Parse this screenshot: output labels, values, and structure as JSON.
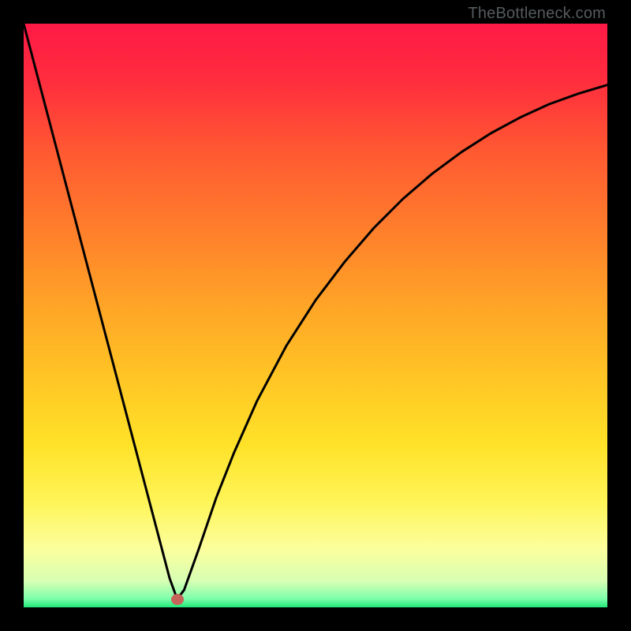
{
  "watermark": "TheBottleneck.com",
  "gradient_stops": [
    {
      "offset": 0.0,
      "color": "#ff1a46"
    },
    {
      "offset": 0.1,
      "color": "#ff2e3e"
    },
    {
      "offset": 0.22,
      "color": "#ff5a32"
    },
    {
      "offset": 0.35,
      "color": "#ff7e2c"
    },
    {
      "offset": 0.48,
      "color": "#ffa427"
    },
    {
      "offset": 0.6,
      "color": "#ffc425"
    },
    {
      "offset": 0.72,
      "color": "#ffe228"
    },
    {
      "offset": 0.82,
      "color": "#fff559"
    },
    {
      "offset": 0.9,
      "color": "#fcff9e"
    },
    {
      "offset": 0.955,
      "color": "#d8ffb4"
    },
    {
      "offset": 0.985,
      "color": "#7fffac"
    },
    {
      "offset": 1.0,
      "color": "#20e87a"
    }
  ],
  "marker": {
    "x_frac": 0.263,
    "y_frac": 0.986,
    "color": "#c56459"
  },
  "chart_data": {
    "type": "line",
    "title": "",
    "xlabel": "",
    "ylabel": "",
    "xlim": [
      0,
      100
    ],
    "ylim": [
      0,
      100
    ],
    "grid": false,
    "legend": false,
    "series": [
      {
        "name": "curve",
        "x": [
          0,
          5,
          10,
          15,
          20,
          23,
          25,
          26.3,
          27.5,
          30,
          33,
          36,
          40,
          45,
          50,
          55,
          60,
          65,
          70,
          75,
          80,
          85,
          90,
          95,
          100
        ],
        "y": [
          100,
          81,
          62,
          43,
          24,
          12.6,
          5,
          1.4,
          3,
          10,
          18.8,
          26.4,
          35.4,
          44.8,
          52.6,
          59.2,
          65,
          70,
          74.3,
          78,
          81.2,
          83.9,
          86.2,
          88,
          89.5
        ]
      }
    ],
    "marker_point": {
      "x": 26.3,
      "y": 1.4
    }
  }
}
